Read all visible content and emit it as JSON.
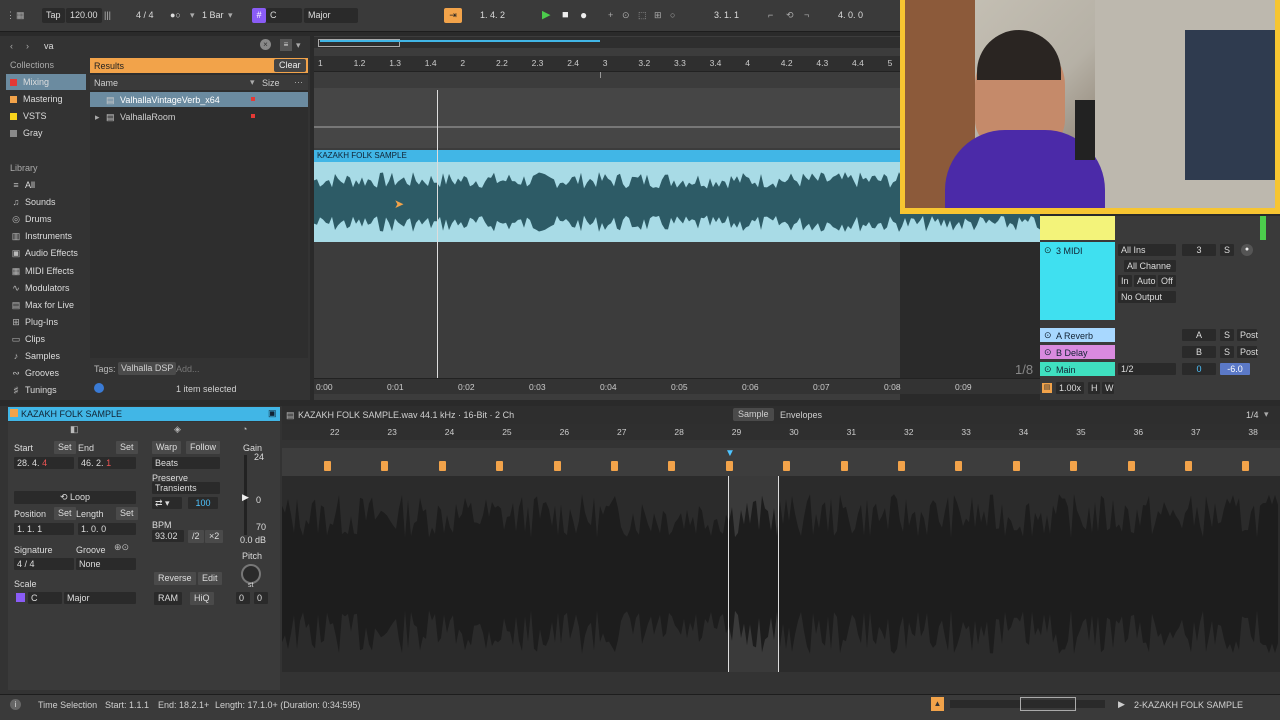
{
  "transport": {
    "tap": "Tap",
    "tempo": "120.00",
    "signature": "4 / 4",
    "quantize": "1 Bar",
    "key": "C",
    "scale": "Major",
    "position": "1.  4.  2",
    "loop_start": "3.  1.  1",
    "loop_length": "4.  0.  0"
  },
  "browser": {
    "search_value": "va",
    "collections_label": "Collections",
    "collections": [
      {
        "label": "Mixing",
        "color": "#e53935"
      },
      {
        "label": "Mastering",
        "color": "#f2a34a"
      },
      {
        "label": "VSTS",
        "color": "#f7d31c"
      },
      {
        "label": "Gray",
        "color": "#8a8a8a"
      }
    ],
    "library_label": "Library",
    "library": [
      "All",
      "Sounds",
      "Drums",
      "Instruments",
      "Audio Effects",
      "MIDI Effects",
      "Modulators",
      "Max for Live",
      "Plug-Ins",
      "Clips",
      "Samples",
      "Grooves",
      "Tunings"
    ],
    "results_label": "Results",
    "clear_label": "Clear",
    "col_name": "Name",
    "col_size": "Size",
    "results": [
      "ValhallaVintageVerb_x64",
      "ValhallaRoom"
    ],
    "tags_label": "Tags:",
    "tag": "Valhalla DSP",
    "tag_add": "Add...",
    "status": "1 item selected"
  },
  "arrangement": {
    "ruler": [
      "1",
      "1.2",
      "1.3",
      "1.4",
      "2",
      "2.2",
      "2.3",
      "2.4",
      "3",
      "3.2",
      "3.3",
      "3.4",
      "4",
      "4.2",
      "4.3",
      "4.4",
      "5"
    ],
    "clip_name": "KAZAKH FOLK SAMPLE",
    "quantize_display": "1/8",
    "timeline": [
      "0:00",
      "0:01",
      "0:02",
      "0:03",
      "0:04",
      "0:05",
      "0:06",
      "0:07",
      "0:08",
      "0:09"
    ]
  },
  "mixer": {
    "midi_track": "3 MIDI",
    "input_type": "All Ins",
    "input_channel": "All Channe",
    "monitor_in": "In",
    "monitor_auto": "Auto",
    "monitor_off": "Off",
    "output": "No Output",
    "track_number": "3",
    "solo": "S",
    "returns": [
      {
        "name": "A Reverb",
        "letter": "A",
        "post": "Post",
        "color": "#a8d8ff"
      },
      {
        "name": "B Delay",
        "letter": "B",
        "post": "Post",
        "color": "#d98adf"
      }
    ],
    "main_name": "Main",
    "main_out": "1/2",
    "main_pan": "0",
    "main_vol": "-6.0",
    "zoom": "1.00x",
    "h": "H",
    "w": "W"
  },
  "clip": {
    "name": "KAZAKH FOLK SAMPLE",
    "start_label": "Start",
    "end_label": "End",
    "set_label": "Set",
    "start_value": [
      "28.",
      "4.",
      "4"
    ],
    "end_value": [
      "46.",
      "2.",
      "1"
    ],
    "loop_label": "Loop",
    "position_label": "Position",
    "length_label": "Length",
    "position_value": [
      "1.",
      "1.",
      "1"
    ],
    "length_value": [
      "1.",
      "0.",
      "0"
    ],
    "signature_label": "Signature",
    "signature_num": "4",
    "signature_den": "4",
    "groove_label": "Groove",
    "groove_value": "None",
    "scale_label": "Scale",
    "scale_key": "C",
    "scale_mode": "Major",
    "warp": "Warp",
    "follow": "Follow",
    "warp_mode": "Beats",
    "preserve_label": "Preserve",
    "preserve_value": "Transients",
    "transient_value": "100",
    "bpm_label": "BPM",
    "bpm_value": "93.02",
    "half": "/2",
    "double": "×2",
    "reverse": "Reverse",
    "edit": "Edit",
    "ram": "RAM",
    "hiq": "HiQ",
    "gain_label": "Gain",
    "gain_top": "24",
    "gain_mid": "0",
    "gain_bot": "70",
    "gain_value": "0.0 dB",
    "pitch_label": "Pitch",
    "pitch_unit": "st",
    "pitch_semis": "0",
    "pitch_cents": "0"
  },
  "sample": {
    "info": "KAZAKH FOLK SAMPLE.wav  44.1 kHz · 16-Bit · 2 Ch",
    "tab_sample": "Sample",
    "tab_envelopes": "Envelopes",
    "grid": "1/4",
    "ruler": [
      "22",
      "23",
      "24",
      "25",
      "26",
      "27",
      "28",
      "29",
      "30",
      "31",
      "32",
      "33",
      "34",
      "35",
      "36",
      "37",
      "38"
    ]
  },
  "status": {
    "mode": "Time Selection",
    "start": "Start: 1.1.1",
    "end": "End: 18.2.1+",
    "length": "Length: 17.1.0+ (Duration: 0:34:595)",
    "track": "2-KAZAKH FOLK SAMPLE"
  }
}
